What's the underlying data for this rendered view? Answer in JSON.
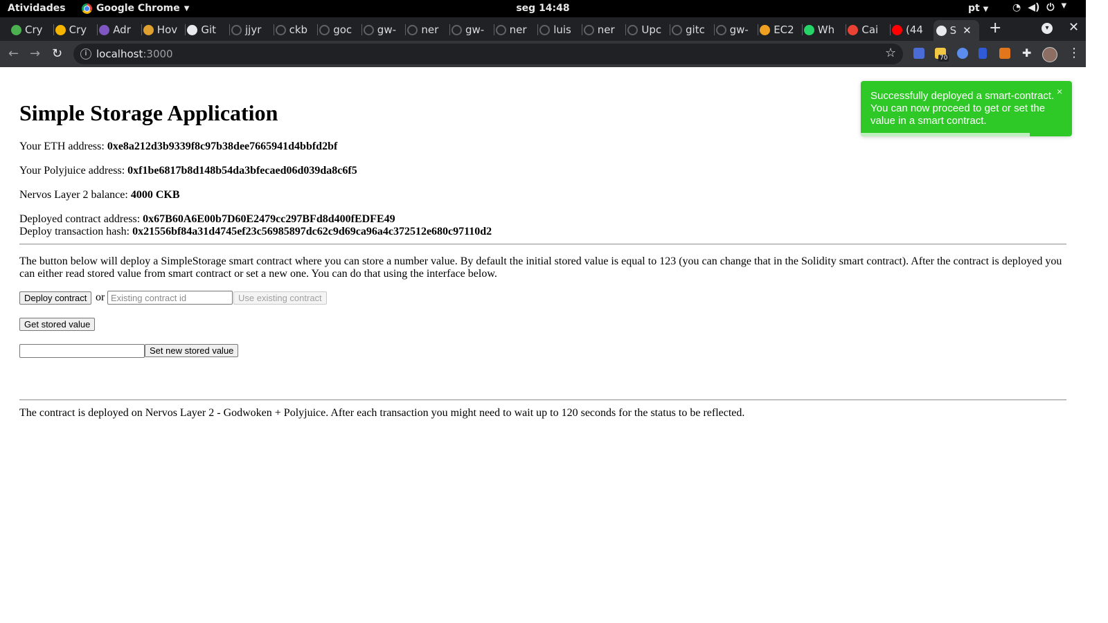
{
  "topbar": {
    "activities": "Atividades",
    "app_name": "Google Chrome",
    "clock": "seg 14:48",
    "language": "pt"
  },
  "tabs": [
    {
      "title": "Cry",
      "icon": "cube-icon",
      "color": "#4caf50"
    },
    {
      "title": "Cry",
      "icon": "c-logo-icon",
      "color": "#f4b400"
    },
    {
      "title": "Adr",
      "icon": "purple-app-icon",
      "color": "#7e57c2"
    },
    {
      "title": "Hov",
      "icon": "orange-app-icon",
      "color": "#e0a030"
    },
    {
      "title": "Git",
      "icon": "gitter-icon",
      "color": "#e8eaed"
    },
    {
      "title": "jjyr",
      "icon": "github-icon"
    },
    {
      "title": "ckb",
      "icon": "github-icon"
    },
    {
      "title": "goc",
      "icon": "github-icon"
    },
    {
      "title": "gw-",
      "icon": "github-icon"
    },
    {
      "title": "ner",
      "icon": "github-icon"
    },
    {
      "title": "gw-",
      "icon": "github-icon"
    },
    {
      "title": "ner",
      "icon": "github-icon"
    },
    {
      "title": "luis",
      "icon": "github-icon"
    },
    {
      "title": "ner",
      "icon": "github-icon"
    },
    {
      "title": "Upc",
      "icon": "github-icon"
    },
    {
      "title": "gitc",
      "icon": "github-icon"
    },
    {
      "title": "gw-",
      "icon": "github-icon"
    },
    {
      "title": "EC2",
      "icon": "aws-box-icon",
      "color": "#f0a020"
    },
    {
      "title": "Wh",
      "icon": "whatsapp-icon",
      "color": "#25d366"
    },
    {
      "title": "Cai",
      "icon": "gmail-icon",
      "color": "#ea4335"
    },
    {
      "title": "(44",
      "icon": "youtube-icon",
      "color": "#ff0000"
    },
    {
      "title": "S",
      "icon": "globe-icon",
      "color": "#e8eaed"
    }
  ],
  "toolbar": {
    "url_host": "localhost",
    "url_port": ":3000",
    "extension_badge": "70"
  },
  "app": {
    "title": "Simple Storage Application",
    "eth_label": "Your ETH address: ",
    "eth_value": "0xe8a212d3b9339f8c97b38dee7665941d4bbfd2bf",
    "polyjuice_label": "Your Polyjuice address: ",
    "polyjuice_value": "0xf1be6817b8d148b54da3bfecaed06d039da8c6f5",
    "balance_label": "Nervos Layer 2 balance: ",
    "balance_value": "4000 CKB",
    "contract_label": "Deployed contract address: ",
    "contract_value": "0x67B60A6E00b7D60E2479cc297BFd8d400fEDFE49",
    "tx_label": "Deploy transaction hash: ",
    "tx_value": "0x21556bf84a31d4745ef23c56985897dc62c9d69ca96a4c372512e680c97110d2",
    "description": "The button below will deploy a SimpleStorage smart contract where you can store a number value. By default the initial stored value is equal to 123 (you can change that in the Solidity smart contract). After the contract is deployed you can either read stored value from smart contract or set a new one. You can do that using the interface below.",
    "deploy_button": "Deploy contract",
    "or_text": "or",
    "existing_placeholder": "Existing contract id",
    "use_existing_button": "Use existing contract",
    "get_value_button": "Get stored value",
    "new_value": "",
    "set_value_button": "Set new stored value",
    "footer": "The contract is deployed on Nervos Layer 2 - Godwoken + Polyjuice. After each transaction you might need to wait up to 120 seconds for the status to be reflected."
  },
  "toast": {
    "message": "Successfully deployed a smart-contract. You can now proceed to get or set the value in a smart contract.",
    "close": "×",
    "color": "#2ec927",
    "progress": 0.8
  }
}
